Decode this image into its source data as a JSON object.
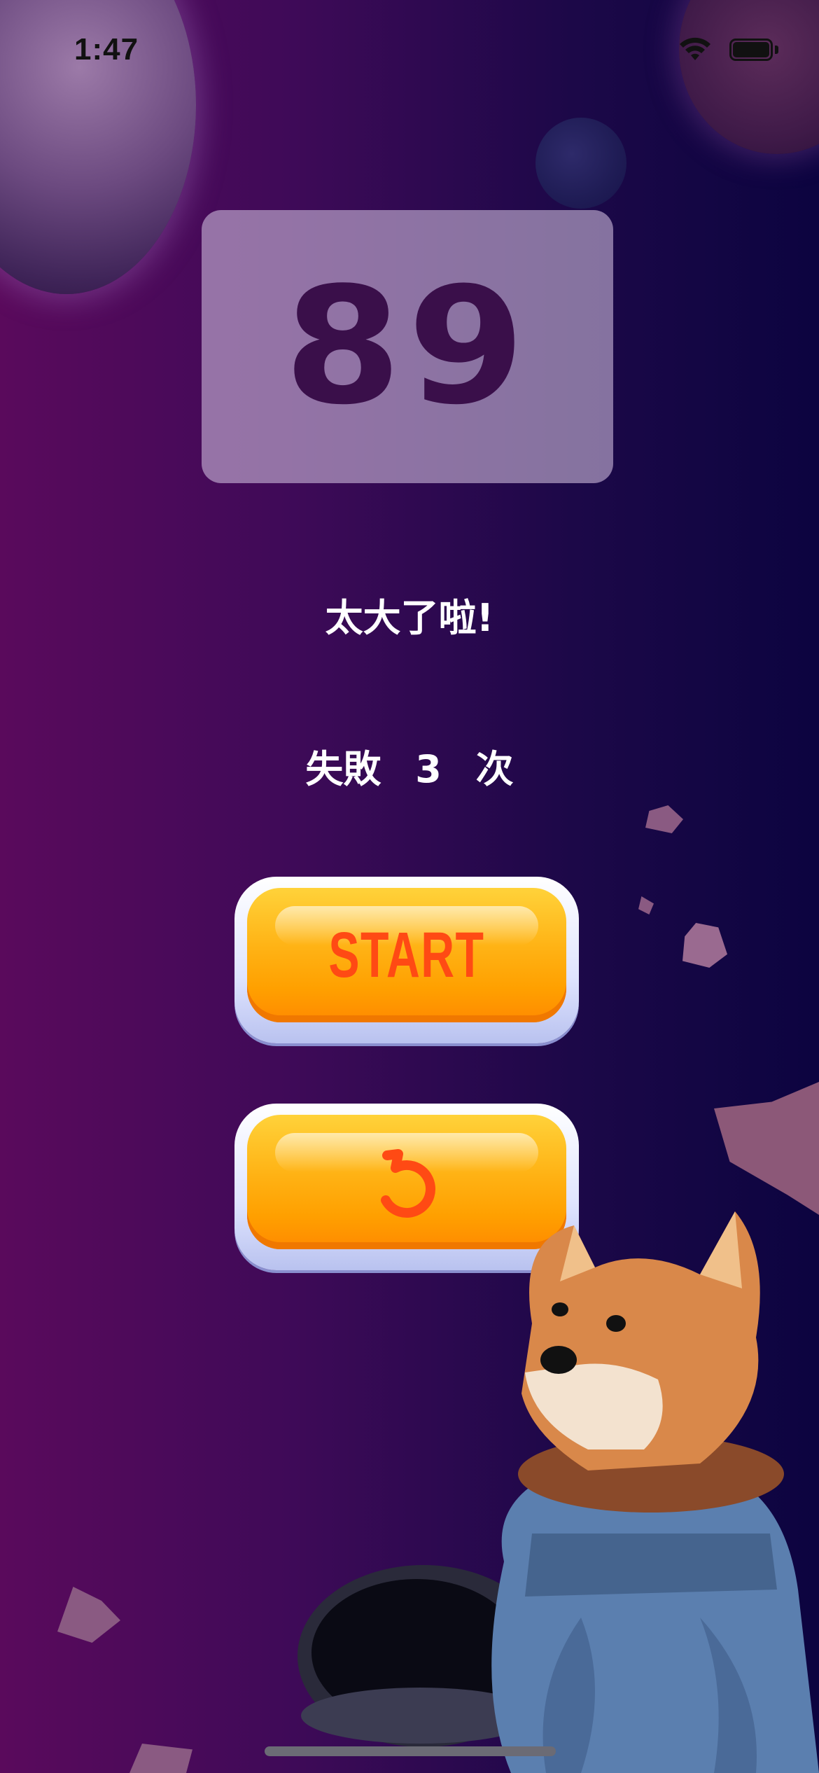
{
  "status_bar": {
    "time": "1:47"
  },
  "game": {
    "guess_number": "89",
    "hint": "太大了啦!",
    "fail_label": "失敗",
    "fail_count": "3",
    "fail_unit": "次"
  },
  "buttons": {
    "start_label": "START",
    "restart_icon": "undo-arrow-icon"
  },
  "colors": {
    "background_left": "#5a0a5c",
    "background_right": "#0c0440",
    "score_text": "#3a0f4a",
    "button_orange": "#ffb214",
    "button_label": "#ff4a14"
  }
}
